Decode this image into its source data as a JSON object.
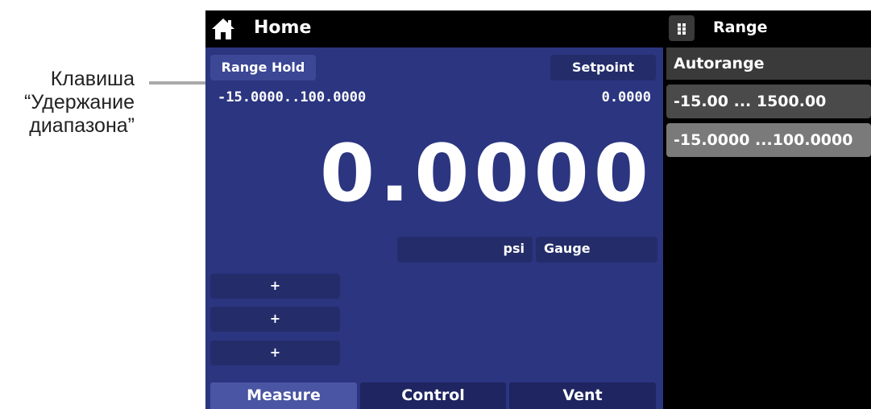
{
  "callout": {
    "line1": "Клавиша",
    "line2": "“Удержание",
    "line3": "диапазона”"
  },
  "header": {
    "title": "Home",
    "icon": "home-icon"
  },
  "main": {
    "range_hold_label": "Range Hold",
    "setpoint_label": "Setpoint",
    "range_text": "-15.0000..100.0000",
    "setpoint_value": "0.0000",
    "reading": "0.0000",
    "unit": "psi",
    "mode": "Gauge",
    "add_buttons": [
      "+",
      "+",
      "+"
    ]
  },
  "tabs": [
    {
      "label": "Measure",
      "active": true
    },
    {
      "label": "Control",
      "active": false
    },
    {
      "label": "Vent",
      "active": false
    }
  ],
  "range_panel": {
    "title": "Range",
    "icon": "grid-icon",
    "items": [
      "Autorange",
      "-15.00 ... 1500.00",
      "-15.0000 ...100.0000"
    ]
  },
  "colors": {
    "main_bg": "#2b3580",
    "button": "#3c4796",
    "button_dark": "#242d6a",
    "panel_item": "#4a4a4a",
    "panel_item_selected": "#7a7a7a"
  }
}
